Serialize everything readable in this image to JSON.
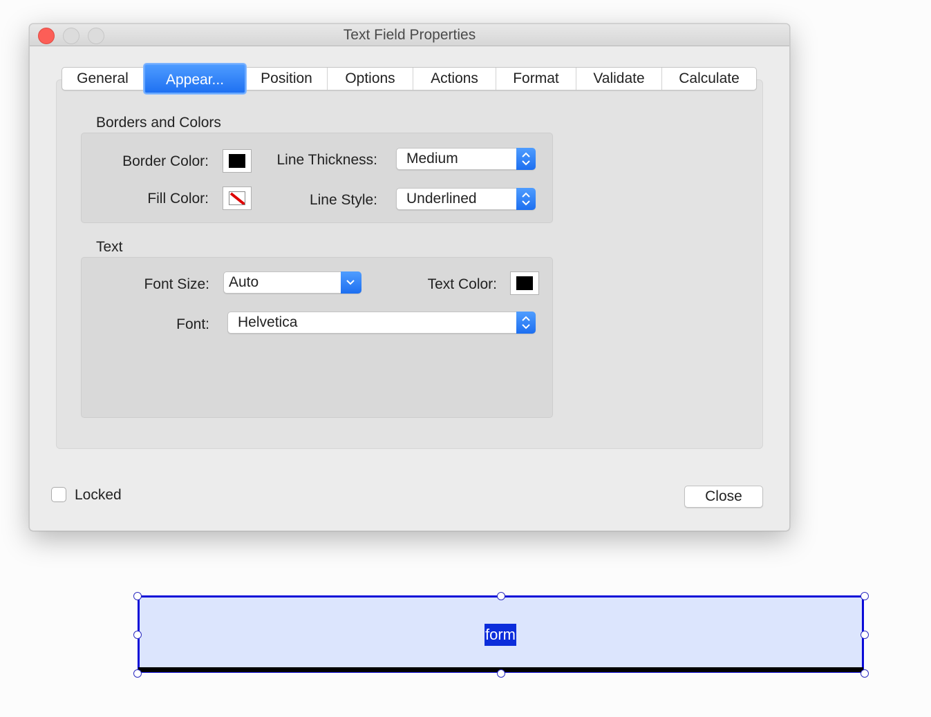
{
  "window": {
    "title": "Text Field Properties"
  },
  "tabs": [
    {
      "label": "General",
      "active": false
    },
    {
      "label": "Appear...",
      "active": true
    },
    {
      "label": "Position",
      "active": false
    },
    {
      "label": "Options",
      "active": false
    },
    {
      "label": "Actions",
      "active": false
    },
    {
      "label": "Format",
      "active": false
    },
    {
      "label": "Validate",
      "active": false
    },
    {
      "label": "Calculate",
      "active": false
    }
  ],
  "borders": {
    "section_title": "Borders and Colors",
    "border_color_label": "Border Color:",
    "border_color": "#000000",
    "fill_color_label": "Fill Color:",
    "fill_color": "none",
    "line_thickness_label": "Line Thickness:",
    "line_thickness_value": "Medium",
    "line_style_label": "Line Style:",
    "line_style_value": "Underlined"
  },
  "text": {
    "section_title": "Text",
    "font_size_label": "Font Size:",
    "font_size_value": "Auto",
    "text_color_label": "Text Color:",
    "text_color": "#000000",
    "font_label": "Font:",
    "font_value": "Helvetica"
  },
  "footer": {
    "locked_label": "Locked",
    "locked_checked": false,
    "close_label": "Close"
  },
  "form_field": {
    "text": "form",
    "fill_color": "#dce5fd",
    "border_color": "#0a0ad8"
  }
}
